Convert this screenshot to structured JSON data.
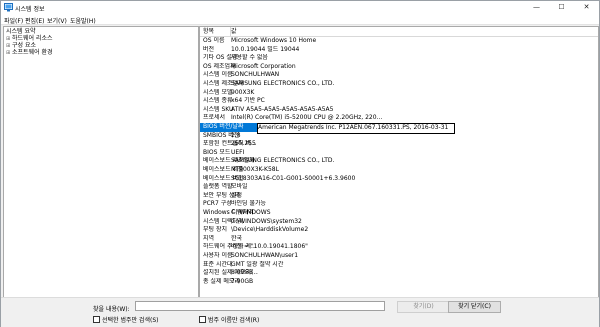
{
  "window": {
    "title": "시스템 정보",
    "minimize": "—",
    "maximize": "☐",
    "close": "✕"
  },
  "menu": [
    "파일(F)",
    "편집(E)",
    "보기(V)",
    "도움말(H)"
  ],
  "tree": {
    "root": "시스템 요약",
    "children": [
      "하드웨어 리소스",
      "구성 요소",
      "소프트웨어 환경"
    ]
  },
  "columns": {
    "item": "항목",
    "value": "값"
  },
  "rows": [
    {
      "item": "OS 이름",
      "value": "Microsoft Windows 10 Home"
    },
    {
      "item": "버전",
      "value": "10.0.19044 빌드 19044"
    },
    {
      "item": "기타 OS 설명",
      "value": "사용할 수 없음"
    },
    {
      "item": "OS 제조업체",
      "value": "Microsoft Corporation"
    },
    {
      "item": "시스템 이름",
      "value": "SONCHULHWAN"
    },
    {
      "item": "시스템 제조업체",
      "value": "SAMSUNG ELECTRONICS CO., LTD."
    },
    {
      "item": "시스템 모델",
      "value": "900X3K"
    },
    {
      "item": "시스템 종류",
      "value": "x64 기반 PC"
    },
    {
      "item": "시스템 SKU",
      "value": "ATIV A5A5-A5A5-A5A5-A5A5-A5A5"
    },
    {
      "item": "프로세서",
      "value": "Intel(R) Core(TM) i5-5200U CPU @ 2.20GHz, 220..."
    },
    {
      "item": "BIOS 버전/날짜",
      "value": "American Megatrends Inc. P12AEN.067.160331.PS, 2016-03-31",
      "selected": true
    },
    {
      "item": "SMBIOS 버전",
      "value": "2.8"
    },
    {
      "item": "포함된 컨트롤러 버...",
      "value": "255.255"
    },
    {
      "item": "BIOS 모드",
      "value": "UEFI"
    },
    {
      "item": "베이스보드 제조업체",
      "value": "SAMSUNG ELECTRONICS CO., LTD."
    },
    {
      "item": "베이스보드 제품",
      "value": "NT900X3K-K58L"
    },
    {
      "item": "베이스보드 버전",
      "value": "SGL8303A16-C01-G001-S0001+6.3.9600"
    },
    {
      "item": "플랫폼 역할",
      "value": "모바일"
    },
    {
      "item": "보안 부팅 상태",
      "value": "설정"
    },
    {
      "item": "PCR7 구성",
      "value": "바인딩 불가능"
    },
    {
      "item": "Windows 디렉터리",
      "value": "C:\\WINDOWS"
    },
    {
      "item": "시스템 디렉터리",
      "value": "C:\\WINDOWS\\system32"
    },
    {
      "item": "부팅 장치",
      "value": "\\Device\\HarddiskVolume2"
    },
    {
      "item": "지역",
      "value": "한국"
    },
    {
      "item": "하드웨어 추상화 계...",
      "value": "버전 = \"10.0.19041.1806\""
    },
    {
      "item": "사용자 이름",
      "value": "SONCHULHWAN\\user1"
    },
    {
      "item": "표준 시간대",
      "value": "GMT 일광 절약 시간"
    },
    {
      "item": "설치된 실제 메모리(...",
      "value": "8.00GB"
    },
    {
      "item": "총 실제 메모리",
      "value": "7.90GB"
    }
  ],
  "find": {
    "label": "찾을 내용(W):",
    "value": "",
    "find_button": "찾기(D)",
    "close_button": "찾기 닫기(C)",
    "check_selected": "선택한 범주만 검색(S)",
    "check_names": "범주 이름만 검색(R)"
  }
}
